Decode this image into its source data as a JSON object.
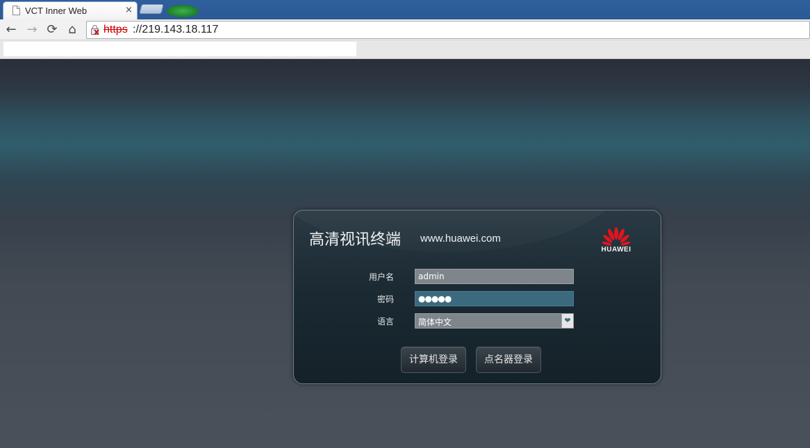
{
  "browser": {
    "tab_title": "VCT Inner Web",
    "tab_close": "×",
    "url_scheme": "https",
    "url_rest": "://219.143.18.117",
    "nav": {
      "back": "←",
      "forward": "→",
      "reload": "⟳",
      "home": "⌂"
    }
  },
  "login": {
    "title": "高清视讯终端",
    "site": "www.huawei.com",
    "brand": "HUAWEI",
    "username_label": "用户名",
    "username_value": "admin",
    "password_label": "密码",
    "password_value": "●●●●●",
    "language_label": "语言",
    "language_value": "简体中文",
    "select_arrow": "❤",
    "computer_login_button": "计算机登录",
    "roll_call_login_button": "点名器登录"
  },
  "colors": {
    "chrome_blue": "#2b5a96",
    "panel_bg": "#1b2a33",
    "huawei_red": "#e0141e"
  }
}
